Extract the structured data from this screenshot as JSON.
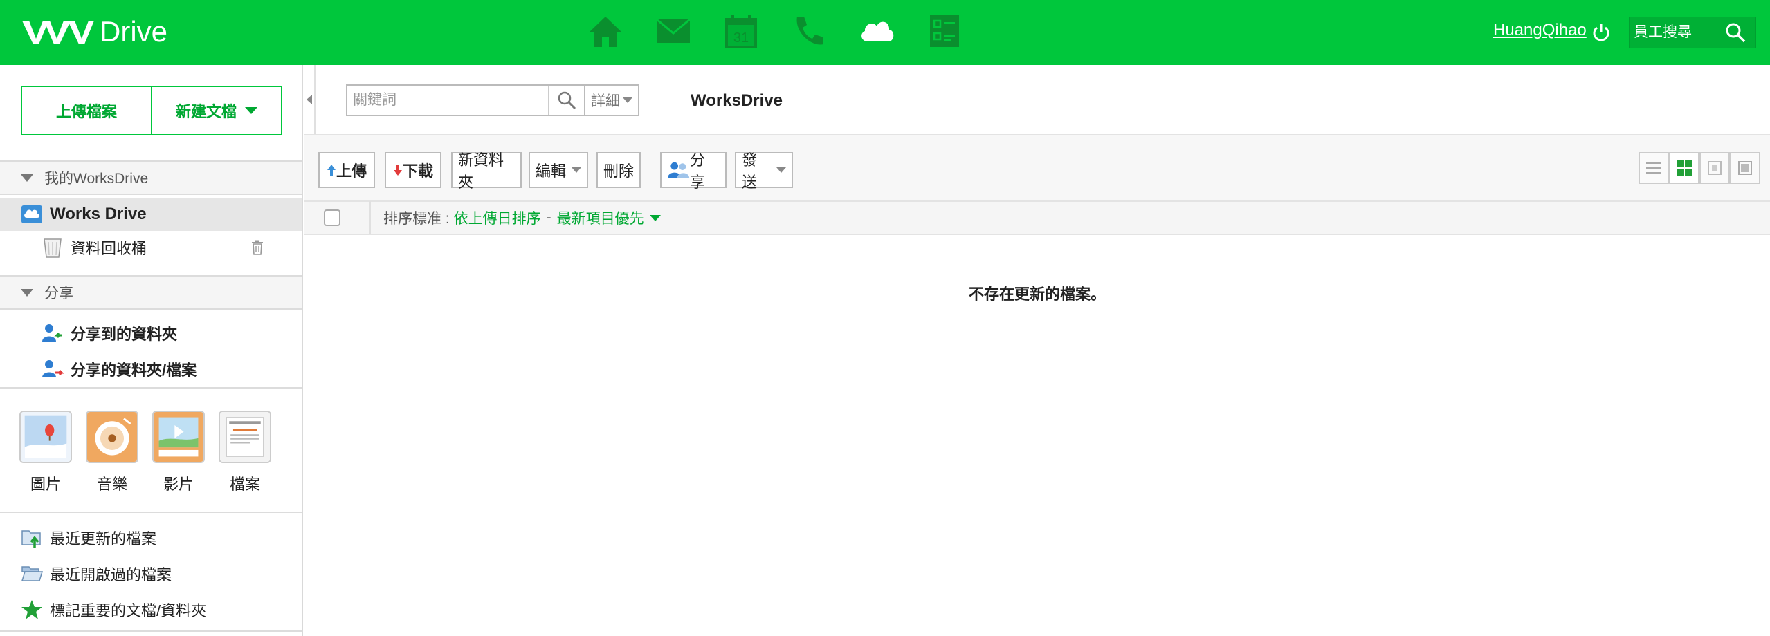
{
  "header": {
    "brand": "Drive",
    "apps": [
      {
        "icon": "home-icon"
      },
      {
        "icon": "mail-icon"
      },
      {
        "icon": "calendar-icon",
        "label": "31"
      },
      {
        "icon": "phone-icon"
      },
      {
        "icon": "cloud-icon"
      },
      {
        "icon": "form-icon"
      }
    ],
    "user": "HuangQihao",
    "search_placeholder": "員工搜尋"
  },
  "sidebar": {
    "upload_label": "上傳檔案",
    "new_doc_label": "新建文檔",
    "my_drive_header": "我的WorksDrive",
    "works_drive": "Works Drive",
    "recycle_bin": "資料回收桶",
    "share_header": "分享",
    "shared_to_folder": "分享到的資料夾",
    "shared_folders_files": "分享的資料夾/檔案",
    "media": [
      {
        "label": "圖片",
        "icon": "picture-icon"
      },
      {
        "label": "音樂",
        "icon": "music-icon"
      },
      {
        "label": "影片",
        "icon": "video-icon"
      },
      {
        "label": "檔案",
        "icon": "document-icon"
      }
    ],
    "recent_updated": "最近更新的檔案",
    "recent_opened": "最近開啟過的檔案",
    "starred": "標記重要的文檔/資料夾"
  },
  "main": {
    "keyword_placeholder": "關鍵詞",
    "detail_label": "詳細",
    "breadcrumb": "WorksDrive",
    "toolbar": {
      "upload": "上傳",
      "download": "下載",
      "new_folder": "新資料夾",
      "edit": "編輯",
      "delete": "刪除",
      "share": "分享",
      "send": "發送"
    },
    "sort": {
      "label": "排序標准 :",
      "by": "依上傳日排序",
      "dash": "-",
      "order": "最新項目優先"
    },
    "empty_message": "不存在更新的檔案。"
  },
  "colors": {
    "brand_green": "#00c73c",
    "link_green": "#00a832"
  }
}
